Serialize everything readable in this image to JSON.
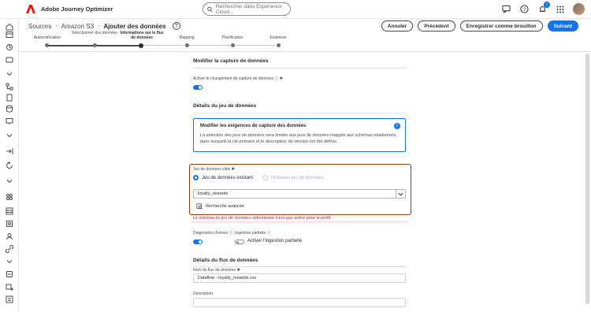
{
  "app": {
    "name": "Adobe Journey Optimizer"
  },
  "search": {
    "placeholder": "Rechercher dans Experience Cloud..."
  },
  "notifications": {
    "count": "7"
  },
  "breadcrumb": {
    "items": [
      "Sources",
      "Amazon S3"
    ],
    "current": "Ajouter des données"
  },
  "steps": [
    {
      "label": "Authentification"
    },
    {
      "label": "Sélectionner des données"
    },
    {
      "label": "Informations sur le flux de données"
    },
    {
      "label": "Mapping"
    },
    {
      "label": "Planification"
    },
    {
      "label": "Examiner"
    }
  ],
  "buttons": {
    "cancel": "Annuler",
    "previous": "Précédent",
    "save_draft": "Enregistrer comme brouillon",
    "next": "Suivant"
  },
  "change_capture": {
    "title": "Modifier la capture de données",
    "toggle_label": "Activer le changement de capture de données",
    "enabled": true
  },
  "dataset_details": {
    "title": "Détails du jeu de données",
    "info_title": "Modifier les exigences de capture des données",
    "info_text": "La sélection des jeux de données sera limitée aux jeux de données mappés aux schémas relationnels, dans lesquels la clé primaire et le descripteur de version ont été définis.",
    "target_label": "Jeu de données cible",
    "existing_label": "Jeu de données existant",
    "new_label": "Nouveau jeu de données",
    "selected_dataset": "loyalty_rewards",
    "advanced_search": "Recherche avancée",
    "warning": "Le schéma du jeu de données sélectionné n'est pas activé pour le profil.",
    "error_diag_label": "Diagnostics d'erreur",
    "error_diag_enabled": true,
    "partial_label": "Ingestion partielle",
    "partial_toggle_label": "Activer l'ingestion partielle",
    "partial_enabled": false
  },
  "flow_details": {
    "title": "Détails du flux de données",
    "name_label": "Nom du flux de données",
    "name_value": "Dataflow - loyalty_rewards.csv",
    "description_label": "Description",
    "description_value": ""
  }
}
